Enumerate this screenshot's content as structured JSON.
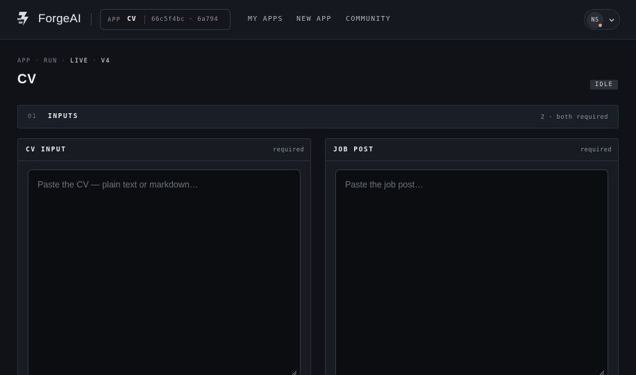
{
  "header": {
    "brand": "ForgeAI",
    "app_pill": {
      "key": "APP",
      "name": "CV",
      "hash": "66c5f4bc · 6a794"
    },
    "nav": [
      "MY APPS",
      "NEW APP",
      "COMMUNITY"
    ],
    "user_initials": "NS",
    "status_color": "#d7a56b"
  },
  "breadcrumb": {
    "items": [
      "APP",
      "RUN",
      "LIVE",
      "V4"
    ],
    "separator": "·"
  },
  "page": {
    "title": "CV",
    "status": "IDLE"
  },
  "section": {
    "number": "01",
    "title": "INPUTS",
    "meta": "2 · both required"
  },
  "panels": [
    {
      "label": "CV INPUT",
      "required": "required",
      "placeholder": "Paste the CV — plain text or markdown…",
      "value": ""
    },
    {
      "label": "JOB POST",
      "required": "required",
      "placeholder": "Paste the job post…",
      "value": ""
    }
  ],
  "icons": {
    "logo": "bolt-stack-logo-icon",
    "chevron": "chevron-down-icon",
    "resize": "resize-grip-icon"
  },
  "colors": {
    "background": "#111217",
    "accent": "#d7a56b",
    "panel": "#181b22"
  }
}
